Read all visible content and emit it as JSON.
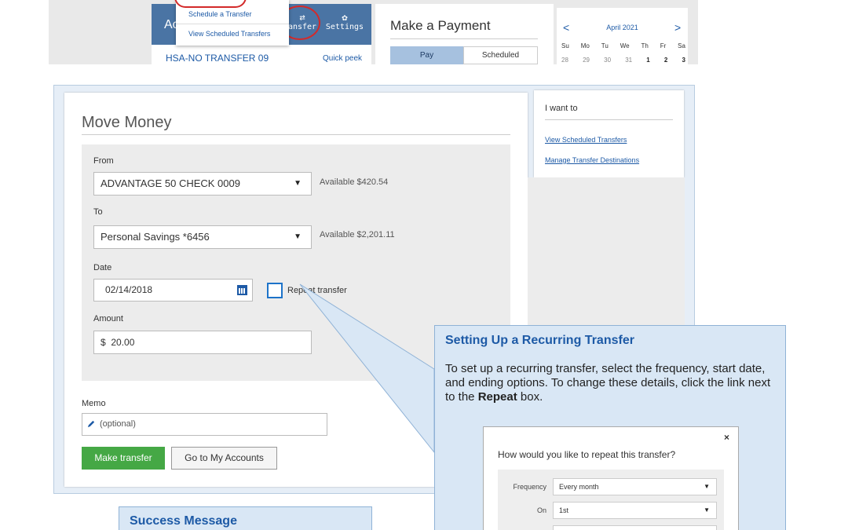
{
  "top": {
    "accounts_header_partial": "Ac",
    "transfer_tab_partial": "ansfer",
    "transfer_icon": "swap-arrows-icon",
    "settings_tab": "Settings",
    "settings_icon": "gear-icon",
    "account_row": "HSA-NO TRANSFER  09",
    "quick_peek": "Quick peek",
    "dropdown": [
      "Schedule a Transfer",
      "View Scheduled Transfers"
    ],
    "payment_title": "Make a Payment",
    "payment_tabs": [
      "Pay",
      "Scheduled"
    ],
    "calendar": {
      "month": "April 2021",
      "days": [
        "Su",
        "Mo",
        "Tu",
        "We",
        "Th",
        "Fr",
        "Sa"
      ],
      "dates": [
        "28",
        "29",
        "30",
        "31",
        "1",
        "2",
        "3"
      ],
      "prev": "<",
      "next": ">"
    }
  },
  "move_money": {
    "title": "Move Money",
    "from_label": "From",
    "from_value": "ADVANTAGE 50 CHECK 0009",
    "from_available": "Available $420.54",
    "to_label": "To",
    "to_value": "Personal Savings *6456",
    "to_available": "Available $2,201.11",
    "date_label": "Date",
    "date_value": "02/14/2018",
    "repeat_label": "Repeat transfer",
    "amount_label": "Amount",
    "amount_value": "$  20.00",
    "memo_label": "Memo",
    "memo_placeholder": "(optional)",
    "make_transfer": "Make transfer",
    "go_to_accounts": "Go to My Accounts"
  },
  "i_want_to": {
    "title": "I want to",
    "links": [
      "View Scheduled Transfers",
      "Manage Transfer Destinations"
    ]
  },
  "recurring_callout": {
    "title": "Setting Up a Recurring Transfer",
    "text_before": "To set up a recurring transfer, select the frequency, start date, and ending options. To change these details, click the link next to the ",
    "text_bold": "Repeat",
    "text_after": " box.",
    "modal": {
      "close": "×",
      "question": "How would you like to repeat this transfer?",
      "frequency_label": "Frequency",
      "frequency_value": "Every month",
      "on_label": "On",
      "on_value": "1st"
    }
  },
  "success_callout": {
    "title": "Success Message"
  },
  "colors": {
    "brand_blue": "#4a74a4",
    "link_blue": "#1d5aa6",
    "success_green": "#45a845",
    "callout_bg": "#d9e7f5",
    "annotation_red": "#d32a2a"
  }
}
